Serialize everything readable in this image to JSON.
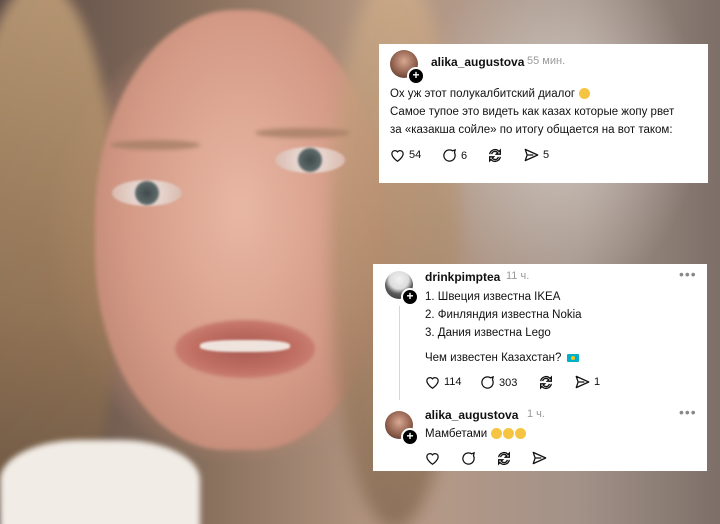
{
  "post1": {
    "username": "alika_augustova",
    "time": "55 мин.",
    "line1": "Ох уж этот полукалбитский диалог",
    "line2": "Самое тупое это видеть как казах которые жопу рвет",
    "line3": "за «казакша сойле» по итогу общается на вот таком:",
    "likes": "54",
    "comments": "6",
    "shares": "5"
  },
  "post2": {
    "username": "drinkpimptea",
    "time": "11 ч.",
    "more": "•••",
    "lines": [
      "1. Швеция известна IKEA",
      "2. Финляндия известна Nokia",
      "3. Дания известна Lego"
    ],
    "question": "Чем известен Казахстан?",
    "likes": "114",
    "comments": "303",
    "shares": "1"
  },
  "reply": {
    "username": "alika_augustova",
    "time": "1 ч.",
    "more": "•••",
    "text": "Мамбетами"
  },
  "colors": {
    "card_bg": "#ffffff",
    "text": "#111111",
    "muted": "#9a9a9a",
    "flag_blue": "#00afca",
    "flag_sun": "#fec50c"
  }
}
